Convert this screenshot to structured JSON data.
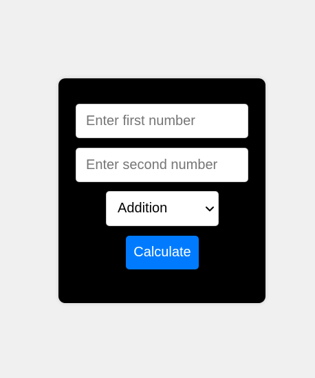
{
  "calculator": {
    "first_number": {
      "value": "",
      "placeholder": "Enter first number"
    },
    "second_number": {
      "value": "",
      "placeholder": "Enter second number"
    },
    "operation": {
      "selected": "Addition",
      "icon": "chevron-down-icon"
    },
    "calculate_label": "Calculate"
  },
  "colors": {
    "page_background": "#f0f0f0",
    "card_background": "#000000",
    "button_background": "#007bff",
    "button_text": "#ffffff"
  }
}
